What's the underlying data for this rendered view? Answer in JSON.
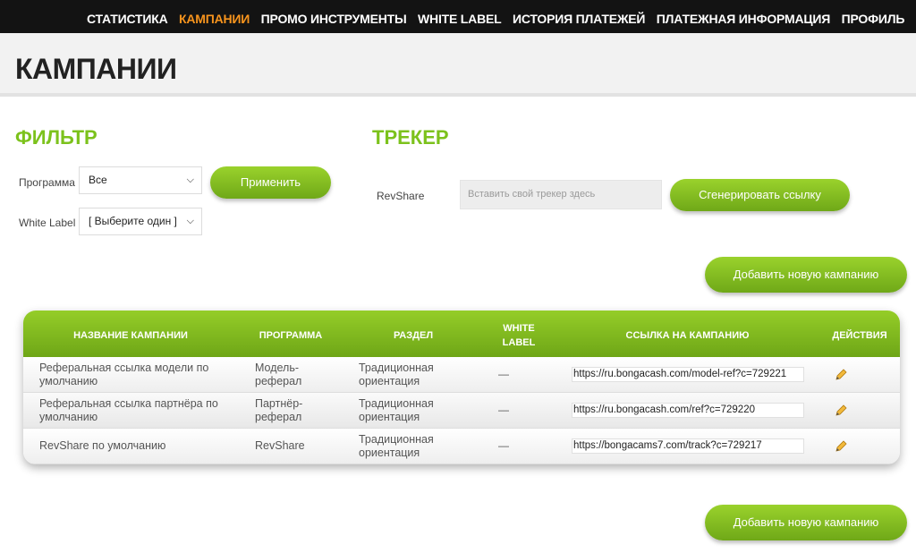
{
  "nav": {
    "items": [
      {
        "label": "СТАТИСТИКА",
        "active": false
      },
      {
        "label": "КАМПАНИИ",
        "active": true
      },
      {
        "label": "ПРОМО ИНСТРУМЕНТЫ",
        "active": false
      },
      {
        "label": "WHITE LABEL",
        "active": false
      },
      {
        "label": "ИСТОРИЯ ПЛАТЕЖЕЙ",
        "active": false
      },
      {
        "label": "ПЛАТЕЖНАЯ ИНФОРМАЦИЯ",
        "active": false
      },
      {
        "label": "ПРОФИЛЬ",
        "active": false
      }
    ]
  },
  "page": {
    "title": "КАМПАНИИ"
  },
  "filter": {
    "title": "ФИЛЬТР",
    "program_label": "Программа",
    "program_value": "Все",
    "whitelabel_label": "White Label",
    "whitelabel_value": "[ Выберите один ]",
    "apply_label": "Применить"
  },
  "tracker": {
    "title": "ТРЕКЕР",
    "label": "RevShare",
    "placeholder": "Вставить свой трекер здесь",
    "generate_label": "Сгенерировать ссылку"
  },
  "add_campaign_label": "Добавить новую кампанию",
  "table": {
    "headers": {
      "name": "НАЗВАНИЕ КАМПАНИИ",
      "program": "ПРОГРАММА",
      "section": "РАЗДЕЛ",
      "whitelabel_1": "WHITE",
      "whitelabel_2": "LABEL",
      "link": "ССЫЛКА НА КАМПАНИЮ",
      "actions": "ДЕЙСТВИЯ"
    },
    "rows": [
      {
        "name_1": "Реферальная ссылка модели по",
        "name_2": "умолчанию",
        "program_1": "Модель-",
        "program_2": "реферал",
        "section_1": "Традиционная",
        "section_2": "ориентация",
        "whitelabel": "—",
        "link": "https://ru.bongacash.com/model-ref?c=729221"
      },
      {
        "name_1": "Реферальная ссылка партнёра по",
        "name_2": "умолчанию",
        "program_1": "Партнёр-",
        "program_2": "реферал",
        "section_1": "Традиционная",
        "section_2": "ориентация",
        "whitelabel": "—",
        "link": "https://ru.bongacash.com/ref?c=729220"
      },
      {
        "name_1": "RevShare по умолчанию",
        "name_2": "",
        "program_1": "RevShare",
        "program_2": "",
        "section_1": "Традиционная",
        "section_2": "ориентация",
        "whitelabel": "—",
        "link": "https://bongacams7.com/track?c=729217"
      }
    ]
  },
  "colors": {
    "accent_green": "#7cc21c",
    "nav_active": "#f7941d",
    "nav_bg": "#131313"
  }
}
